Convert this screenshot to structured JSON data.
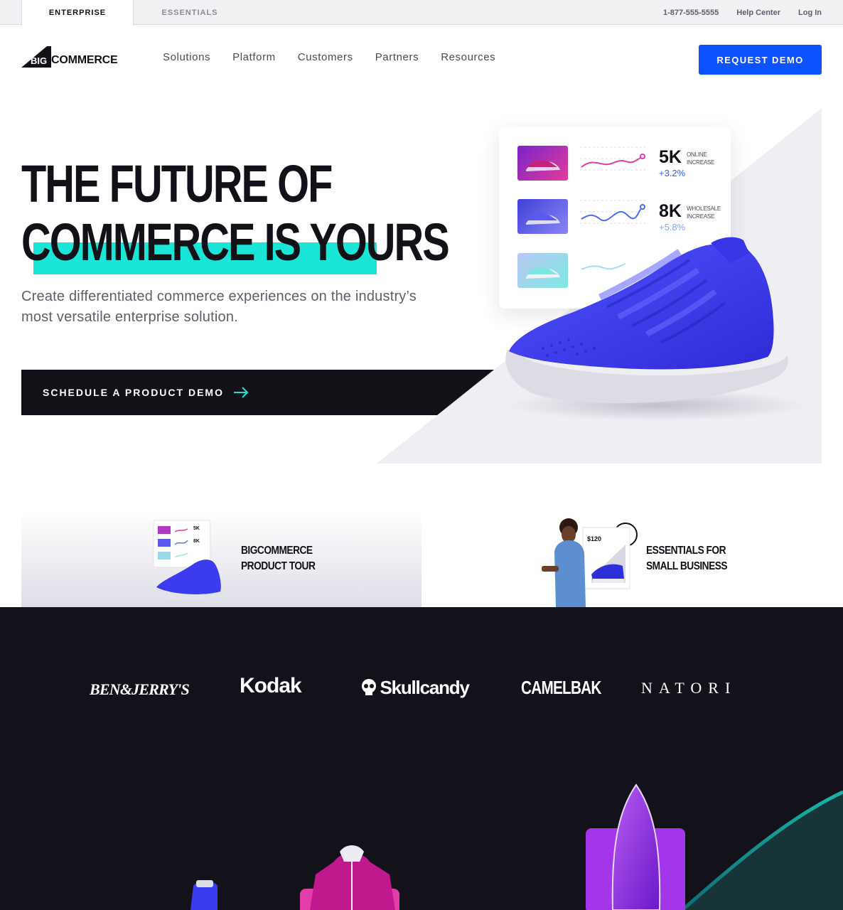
{
  "utility": {
    "tabs": [
      {
        "label": "ENTERPRISE",
        "active": true
      },
      {
        "label": "ESSENTIALS",
        "active": false
      }
    ],
    "phone": "1-877-555-5555",
    "help": "Help Center",
    "login": "Log In"
  },
  "brand": {
    "logo_big": "BIG",
    "logo_word": "COMMERCE"
  },
  "nav": {
    "items": [
      "Solutions",
      "Platform",
      "Customers",
      "Partners",
      "Resources"
    ],
    "cta": "REQUEST DEMO"
  },
  "hero": {
    "title_line1": "THE FUTURE OF",
    "title_line2": "COMMERCE IS YOURS",
    "subtitle": "Create differentiated commerce experiences on the industry’s most versatile enterprise solution.",
    "cta": "SCHEDULE A PRODUCT DEMO"
  },
  "dashboard": {
    "rows": [
      {
        "value": "5K",
        "caption_1": "ONLINE",
        "caption_2": "INCREASE",
        "change": "+3.2%"
      },
      {
        "value": "8K",
        "caption_1": "WHOLESALE",
        "caption_2": "INCREASE",
        "change": "+5.8%"
      }
    ]
  },
  "features": [
    {
      "title_1": "BIGCOMMERCE",
      "title_2": "PRODUCT TOUR",
      "active": true
    },
    {
      "title_1": "ESSENTIALS FOR",
      "title_2": "SMALL BUSINESS",
      "active": false,
      "price": "$120"
    }
  ],
  "mini_dash": [
    {
      "value": "5K"
    },
    {
      "value": "8K"
    }
  ],
  "customers": [
    "BEN&JERRY'S",
    "Kodak",
    "Skullcandy",
    "CAMELBAK",
    "NATORI"
  ],
  "colors": {
    "accent_blue": "#0d52ff",
    "highlight_teal": "#1ae5d6",
    "dark_bg": "#13121a",
    "shoe_blue": "#3f3ef2"
  }
}
